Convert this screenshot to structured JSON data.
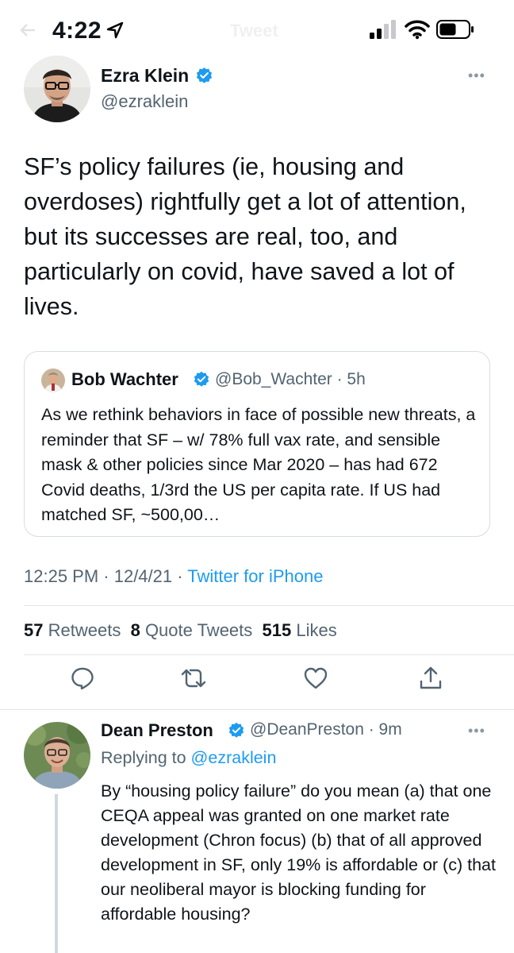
{
  "status_bar": {
    "time": "4:22",
    "ghost_title": "Tweet"
  },
  "colors": {
    "accent": "#1d9bf0",
    "text_primary": "#0f1419",
    "text_secondary": "#536471",
    "divider": "#e1e6ea"
  },
  "main_tweet": {
    "author_name": "Ezra Klein",
    "author_handle": "@ezraklein",
    "verified": true,
    "more_label": "•••",
    "text": "SF’s policy failures (ie, housing and overdoses) rightfully get a lot of attention, but its successes are real, too, and particularly on covid, have saved a lot of lives.",
    "quoted_tweet": {
      "author_name": "Bob Wachter",
      "meta": "@Bob_Wachter · 5h",
      "verified": true,
      "text": "As we rethink behaviors in face of possible new threats, a reminder that SF – w/ 78% full vax rate, and sensible mask & other policies since Mar 2020 – has had 672 Covid deaths, 1/3rd the US per capita rate. If US had matched SF, ~500,00…"
    },
    "timestamp": "12:25 PM · 12/4/21 · ",
    "source": "Twitter for iPhone",
    "stats": {
      "retweets_count": "57",
      "retweets_label": "Retweets",
      "quotes_count": "8",
      "quotes_label": "Quote Tweets",
      "likes_count": "515",
      "likes_label": "Likes"
    },
    "actions": [
      "reply-icon",
      "retweet-icon",
      "like-icon",
      "share-icon"
    ]
  },
  "reply": {
    "author_name": "Dean Preston",
    "meta": "@DeanPreston · 9m",
    "verified": true,
    "more_label": "•••",
    "replying_prefix": "Replying to ",
    "replying_to": "@ezraklein",
    "text": "By “housing policy failure” do you mean (a) that one CEQA appeal was granted on one market rate development (Chron focus) (b) that of all approved development in SF, only 19% is affordable or (c) that our neoliberal mayor is blocking funding for affordable housing?"
  }
}
